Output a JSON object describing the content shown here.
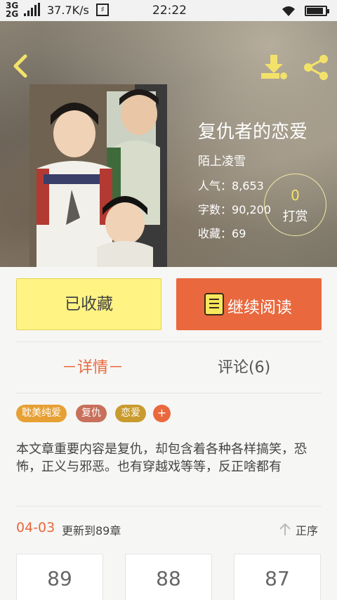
{
  "status_bar": {
    "network_top": "3G",
    "network_bottom": "2G",
    "speed": "37.7K/s",
    "sim_icon": "sim-card-icon",
    "time": "22:22",
    "battery_level": 0.9
  },
  "header": {
    "back_icon": "chevron-left-icon",
    "download_icon": "download-icon",
    "share_icon": "share-icon"
  },
  "book": {
    "title": "复仇者的恋爱",
    "author": "陌上凌雪",
    "popularity_label": "人气：",
    "popularity": "8,653",
    "words_label": "字数：",
    "words": "90,200",
    "favorites_label": "收藏：",
    "favorites": "69",
    "tip_count": "0",
    "tip_label": "打赏"
  },
  "actions": {
    "favorited_label": "已收藏",
    "continue_label": "继续阅读",
    "continue_icon": "book-icon"
  },
  "tabs": {
    "details": "－详情－",
    "comments": "评论(6)"
  },
  "tags": [
    {
      "label": "耽美纯爱",
      "color": "#e7a033"
    },
    {
      "label": "复仇",
      "color": "#c8705c"
    },
    {
      "label": "恋爱",
      "color": "#c99b2f"
    }
  ],
  "tag_add": "+",
  "description": "本文章重要内容是复仇，却包含着各种各样搞笑，恐怖，正义与邪恶。也有穿越戏等等，反正啥都有",
  "update": {
    "date": "04-03",
    "text": "更新到89章",
    "sort_label": "正序",
    "sort_icon": "arrow-up-icon"
  },
  "chapters": [
    "89",
    "88",
    "87"
  ],
  "colors": {
    "accent": "#e9683d",
    "favorite_button": "#fff383",
    "tip_count": "#f3e26a"
  }
}
